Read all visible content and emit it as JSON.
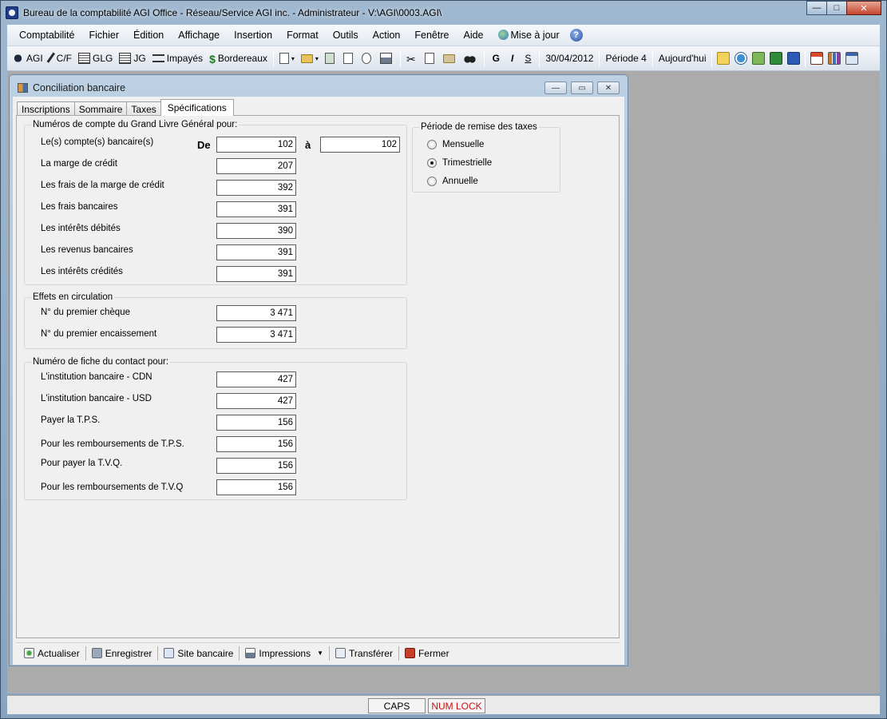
{
  "window": {
    "title": "Bureau de la comptabilité AGI Office - Réseau/Service AGI inc. - Administrateur - V:\\AGI\\0003.AGI\\",
    "controls": {
      "minimize": "—",
      "maximize": "□",
      "close": "✕"
    }
  },
  "menu": {
    "items": [
      "Comptabilité",
      "Fichier",
      "Édition",
      "Affichage",
      "Insertion",
      "Format",
      "Outils",
      "Action",
      "Fenêtre",
      "Aide"
    ],
    "update": "Mise à jour",
    "help": "?"
  },
  "toolbar": {
    "agi": "AGI",
    "cf": "C/F",
    "glg": "GLG",
    "jg": "JG",
    "impayes": "Impayés",
    "bordereaux": "Bordereaux",
    "bold": "G",
    "italic": "I",
    "underline": "S",
    "date": "30/04/2012",
    "period": "Période 4",
    "today": "Aujourd'hui"
  },
  "child": {
    "title": "Conciliation bancaire",
    "controls": {
      "minimize": "—",
      "maximize": "▭",
      "close": "✕"
    },
    "tabs": [
      "Inscriptions",
      "Sommaire",
      "Taxes",
      "Spécifications"
    ],
    "group_gl": {
      "title": "Numéros de compte du Grand Livre Général pour:",
      "de": "De",
      "a": "à",
      "rows": [
        {
          "label": "Le(s) compte(s) bancaire(s)",
          "value": "102",
          "value_to": "102"
        },
        {
          "label": "La marge de crédit",
          "value": "207"
        },
        {
          "label": "Les frais de la marge de crédit",
          "value": "392"
        },
        {
          "label": "Les frais bancaires",
          "value": "391"
        },
        {
          "label": "Les intérêts débités",
          "value": "390"
        },
        {
          "label": "Les revenus bancaires",
          "value": "391"
        },
        {
          "label": "Les intérêts crédités",
          "value": "391"
        }
      ]
    },
    "group_effets": {
      "title": "Effets en circulation",
      "rows": [
        {
          "label": "N° du premier chèque",
          "value": "3 471"
        },
        {
          "label": "N° du premier encaissement",
          "value": "3 471"
        }
      ]
    },
    "group_contact": {
      "title": "Numéro de fiche du contact pour:",
      "rows": [
        {
          "label": "L'institution bancaire - CDN",
          "value": "427"
        },
        {
          "label": "L'institution bancaire - USD",
          "value": "427"
        },
        {
          "label": "Payer la T.P.S.",
          "value": "156"
        },
        {
          "label": "Pour les remboursements de T.P.S.",
          "value": "156"
        },
        {
          "label": "Pour payer la T.V.Q.",
          "value": "156"
        },
        {
          "label": "Pour les remboursements de T.V.Q",
          "value": "156"
        }
      ]
    },
    "group_period": {
      "title": "Période de remise des taxes",
      "options": [
        "Mensuelle",
        "Trimestrielle",
        "Annuelle"
      ],
      "selected": "Trimestrielle"
    },
    "bottom_bar": {
      "refresh": "Actualiser",
      "save": "Enregistrer",
      "bank_site": "Site bancaire",
      "prints": "Impressions",
      "transfer": "Transférer",
      "close": "Fermer"
    }
  },
  "statusbar": {
    "caps": "CAPS",
    "numlock": "NUM LOCK",
    "numlock_color": "#d01010"
  }
}
